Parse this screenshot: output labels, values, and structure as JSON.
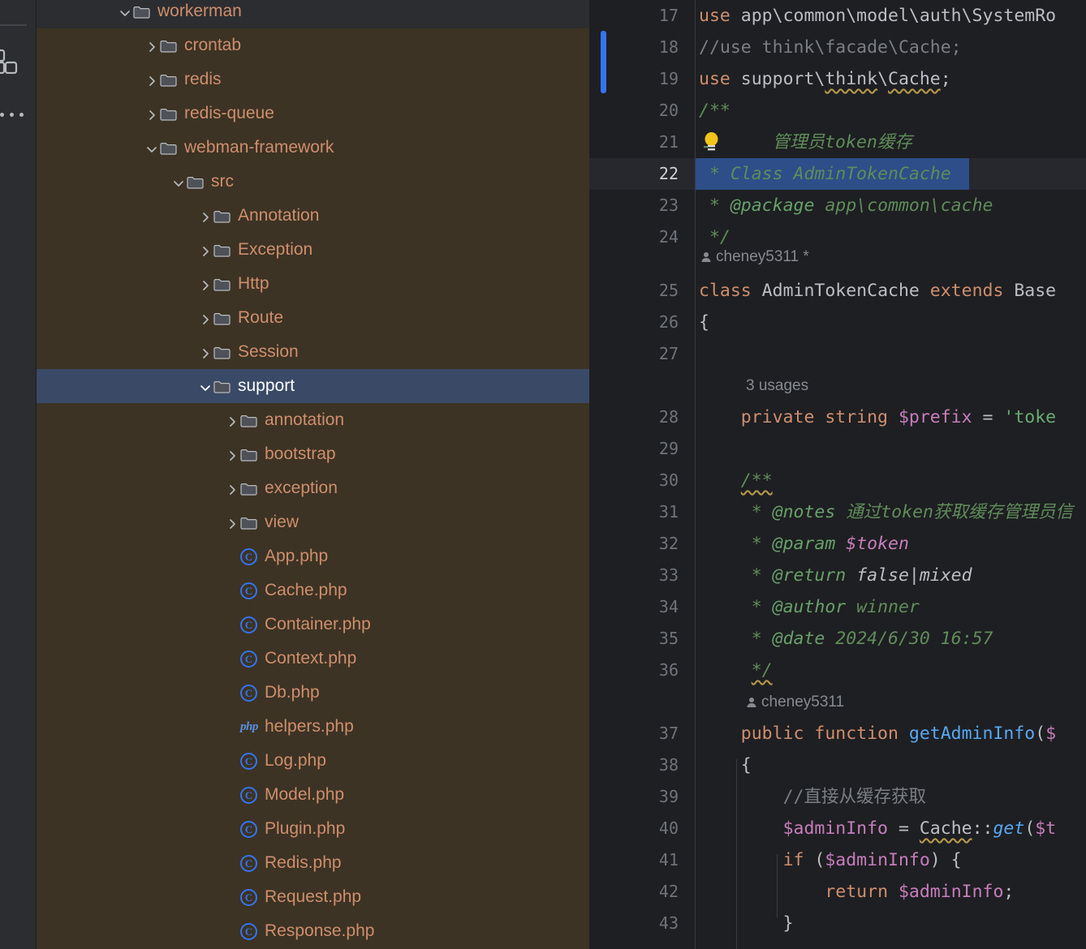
{
  "app": {
    "theme": "dark",
    "colors": {
      "sidebar_bg": "#3c3324",
      "editor_bg": "#1e1f22",
      "rail_bg": "#2b2d30",
      "selection_blue": "#2d4e88",
      "tree_selection": "#3a4a66",
      "folder_text": "#cf8e6d",
      "error_stripe": "#9c2e2e",
      "change_marker": "#3574f0"
    }
  },
  "rail": {
    "items": [
      {
        "name": "structure-icon",
        "label": "Structure"
      },
      {
        "name": "more-tool-windows-icon",
        "label": "More tool windows"
      }
    ]
  },
  "tree": {
    "selected": "support",
    "rows": [
      {
        "label": "workerman",
        "indent": 3,
        "type": "folder",
        "state": "expanded",
        "header": true
      },
      {
        "label": "crontab",
        "indent": 4,
        "type": "folder",
        "state": "collapsed"
      },
      {
        "label": "redis",
        "indent": 4,
        "type": "folder",
        "state": "collapsed"
      },
      {
        "label": "redis-queue",
        "indent": 4,
        "type": "folder",
        "state": "collapsed"
      },
      {
        "label": "webman-framework",
        "indent": 4,
        "type": "folder",
        "state": "expanded"
      },
      {
        "label": "src",
        "indent": 5,
        "type": "folder",
        "state": "expanded"
      },
      {
        "label": "Annotation",
        "indent": 6,
        "type": "folder",
        "state": "collapsed"
      },
      {
        "label": "Exception",
        "indent": 6,
        "type": "folder",
        "state": "collapsed"
      },
      {
        "label": "Http",
        "indent": 6,
        "type": "folder",
        "state": "collapsed"
      },
      {
        "label": "Route",
        "indent": 6,
        "type": "folder",
        "state": "collapsed"
      },
      {
        "label": "Session",
        "indent": 6,
        "type": "folder",
        "state": "collapsed"
      },
      {
        "label": "support",
        "indent": 6,
        "type": "folder",
        "state": "expanded",
        "selected": true
      },
      {
        "label": "annotation",
        "indent": 7,
        "type": "folder",
        "state": "collapsed"
      },
      {
        "label": "bootstrap",
        "indent": 7,
        "type": "folder",
        "state": "collapsed"
      },
      {
        "label": "exception",
        "indent": 7,
        "type": "folder",
        "state": "collapsed"
      },
      {
        "label": "view",
        "indent": 7,
        "type": "folder",
        "state": "collapsed"
      },
      {
        "label": "App.php",
        "indent": 7,
        "type": "php-class"
      },
      {
        "label": "Cache.php",
        "indent": 7,
        "type": "php-class"
      },
      {
        "label": "Container.php",
        "indent": 7,
        "type": "php-class"
      },
      {
        "label": "Context.php",
        "indent": 7,
        "type": "php-class"
      },
      {
        "label": "Db.php",
        "indent": 7,
        "type": "php-class"
      },
      {
        "label": "helpers.php",
        "indent": 7,
        "type": "php-file"
      },
      {
        "label": "Log.php",
        "indent": 7,
        "type": "php-class"
      },
      {
        "label": "Model.php",
        "indent": 7,
        "type": "php-class"
      },
      {
        "label": "Plugin.php",
        "indent": 7,
        "type": "php-class"
      },
      {
        "label": "Redis.php",
        "indent": 7,
        "type": "php-class"
      },
      {
        "label": "Request.php",
        "indent": 7,
        "type": "php-class"
      },
      {
        "label": "Response.php",
        "indent": 7,
        "type": "php-class"
      }
    ]
  },
  "editor": {
    "current_line": 22,
    "first_line": 17,
    "inlay_hints": [
      {
        "text": "cheney5311 *",
        "after_line": 24
      },
      {
        "text": "3 usages",
        "after_line": 27
      },
      {
        "text": "cheney5311",
        "after_line": 36
      }
    ],
    "lines": [
      {
        "n": 17,
        "text": "use app\\common\\model\\auth\\SystemRo"
      },
      {
        "n": 18,
        "text": "//use think\\facade\\Cache;"
      },
      {
        "n": 19,
        "text": "use support\\think\\Cache;"
      },
      {
        "n": 20,
        "text": "/**"
      },
      {
        "n": 21,
        "text": " * 管理员token缓存"
      },
      {
        "n": 22,
        "text": " * Class AdminTokenCache"
      },
      {
        "n": 23,
        "text": " * @package app\\common\\cache"
      },
      {
        "n": 24,
        "text": " */"
      },
      {
        "n": 25,
        "text": "class AdminTokenCache extends Base"
      },
      {
        "n": 26,
        "text": "{"
      },
      {
        "n": 27,
        "text": ""
      },
      {
        "n": 28,
        "text": "    private string $prefix = 'toke"
      },
      {
        "n": 29,
        "text": ""
      },
      {
        "n": 30,
        "text": "    /**"
      },
      {
        "n": 31,
        "text": "     * @notes 通过token获取缓存管理员信"
      },
      {
        "n": 32,
        "text": "     * @param $token"
      },
      {
        "n": 33,
        "text": "     * @return false|mixed"
      },
      {
        "n": 34,
        "text": "     * @author winner"
      },
      {
        "n": 35,
        "text": "     * @date 2024/6/30 16:57"
      },
      {
        "n": 36,
        "text": "     */"
      },
      {
        "n": 37,
        "text": "    public function getAdminInfo($"
      },
      {
        "n": 38,
        "text": "    {"
      },
      {
        "n": 39,
        "text": "        //直接从缓存获取"
      },
      {
        "n": 40,
        "text": "        $adminInfo = Cache::get($t"
      },
      {
        "n": 41,
        "text": "        if ($adminInfo) {"
      },
      {
        "n": 42,
        "text": "            return $adminInfo;"
      },
      {
        "n": 43,
        "text": "        }"
      }
    ]
  }
}
